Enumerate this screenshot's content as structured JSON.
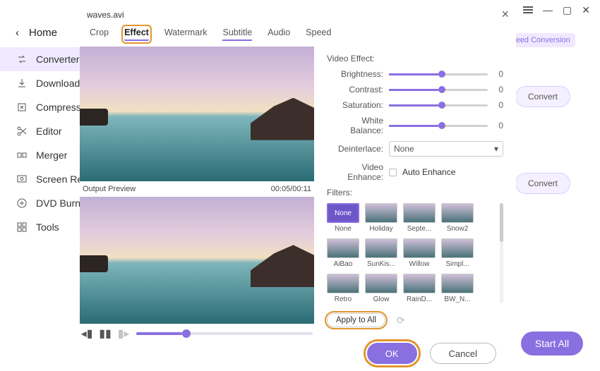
{
  "outer": {
    "speed_label": "Speed Conversion",
    "start_all": "Start All",
    "convert": "Convert"
  },
  "sidebar": {
    "home": "Home",
    "items": [
      {
        "label": "Converter"
      },
      {
        "label": "Downloader"
      },
      {
        "label": "Compressor"
      },
      {
        "label": "Editor"
      },
      {
        "label": "Merger"
      },
      {
        "label": "Screen Record"
      },
      {
        "label": "DVD Burner"
      },
      {
        "label": "Tools"
      }
    ]
  },
  "dialog": {
    "title": "waves.avi",
    "tabs": {
      "crop": "Crop",
      "effect": "Effect",
      "watermark": "Watermark",
      "subtitle": "Subtitle",
      "audio": "Audio",
      "speed": "Speed"
    },
    "preview_label": "Output Preview",
    "time": "00:05/00:11",
    "effects": {
      "heading": "Video Effect:",
      "brightness": {
        "label": "Brightness:",
        "value": 0
      },
      "contrast": {
        "label": "Contrast:",
        "value": 0
      },
      "saturation": {
        "label": "Saturation:",
        "value": 0
      },
      "white_balance": {
        "label": "White Balance:",
        "value": 0
      },
      "deinterlace": {
        "label": "Deinterlace:",
        "value": "None"
      },
      "enhance": {
        "label": "Video Enhance:",
        "option": "Auto Enhance"
      }
    },
    "filters_heading": "Filters:",
    "filters": [
      {
        "label": "None",
        "sel": true
      },
      {
        "label": "Holiday"
      },
      {
        "label": "Septe..."
      },
      {
        "label": "Snow2"
      },
      {
        "label": "AiBao"
      },
      {
        "label": "SunKis..."
      },
      {
        "label": "Willow"
      },
      {
        "label": "Simpl..."
      },
      {
        "label": "Retro"
      },
      {
        "label": "Glow"
      },
      {
        "label": "RainD..."
      },
      {
        "label": "BW_N..."
      }
    ],
    "apply_all": "Apply to All",
    "ok": "OK",
    "cancel": "Cancel"
  }
}
